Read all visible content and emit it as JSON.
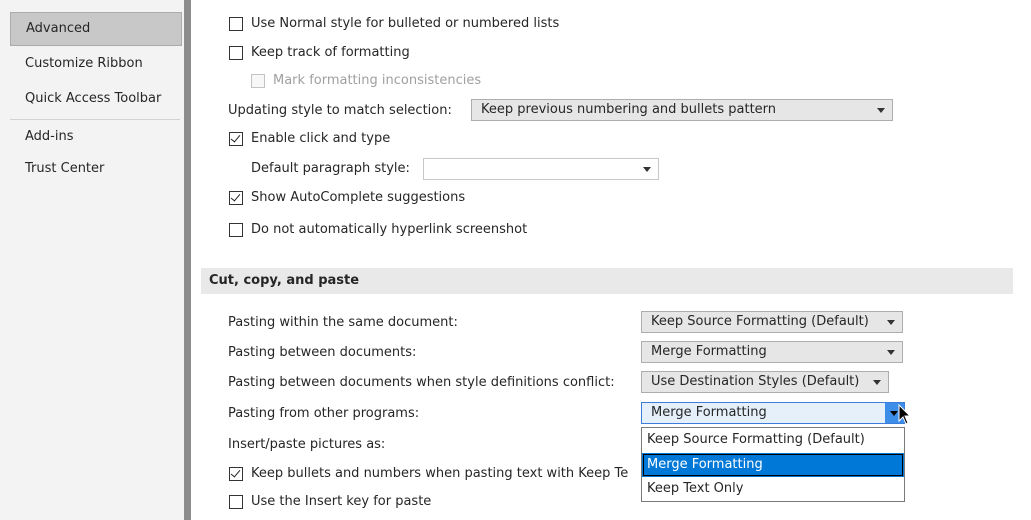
{
  "sidebar": {
    "items": [
      {
        "label": "Advanced",
        "active": true
      },
      {
        "label": "Customize Ribbon"
      },
      {
        "label": "Quick Access Toolbar"
      },
      {
        "label": "Add-ins"
      },
      {
        "label": "Trust Center"
      }
    ]
  },
  "editing": {
    "use_normal_style": {
      "label": "Use Normal style for bulleted or numbered lists",
      "checked": false
    },
    "keep_track": {
      "label": "Keep track of formatting",
      "checked": false
    },
    "mark_inconsistencies": {
      "label": "Mark formatting inconsistencies",
      "checked": false,
      "disabled": true
    },
    "updating_style": {
      "label": "Updating style to match selection:",
      "value": "Keep previous numbering and bullets pattern"
    },
    "enable_click_type": {
      "label": "Enable click and type",
      "checked": true
    },
    "default_paragraph_style": {
      "label": "Default paragraph style:",
      "value": ""
    },
    "show_autocomplete": {
      "label": "Show AutoComplete suggestions",
      "checked": true
    },
    "no_auto_hyperlink": {
      "label": "Do not automatically hyperlink screenshot",
      "checked": false
    }
  },
  "cut_copy_paste": {
    "header": "Cut, copy, and paste",
    "within_doc": {
      "label": "Pasting within the same document:",
      "value": "Keep Source Formatting (Default)"
    },
    "between_docs": {
      "label": "Pasting between documents:",
      "value": "Merge Formatting"
    },
    "between_docs_conflict": {
      "label": "Pasting between documents when style definitions conflict:",
      "value": "Use Destination Styles (Default)"
    },
    "from_other_programs": {
      "label": "Pasting from other programs:",
      "value": "Merge Formatting"
    },
    "insert_pictures": {
      "label": "Insert/paste pictures as:"
    },
    "keep_bullets": {
      "label": "Keep bullets and numbers when pasting text with Keep Te",
      "checked": true
    },
    "use_insert_key": {
      "label": "Use the Insert key for paste",
      "checked": false
    }
  },
  "dropdown": {
    "options": [
      "Keep Source Formatting (Default)",
      "Merge Formatting",
      "Keep Text Only"
    ],
    "selected_index": 1
  },
  "colors": {
    "accent": "#0078d7",
    "sidebar_bg": "#f3f3f3",
    "section_header_bg": "#e9e9e9"
  }
}
